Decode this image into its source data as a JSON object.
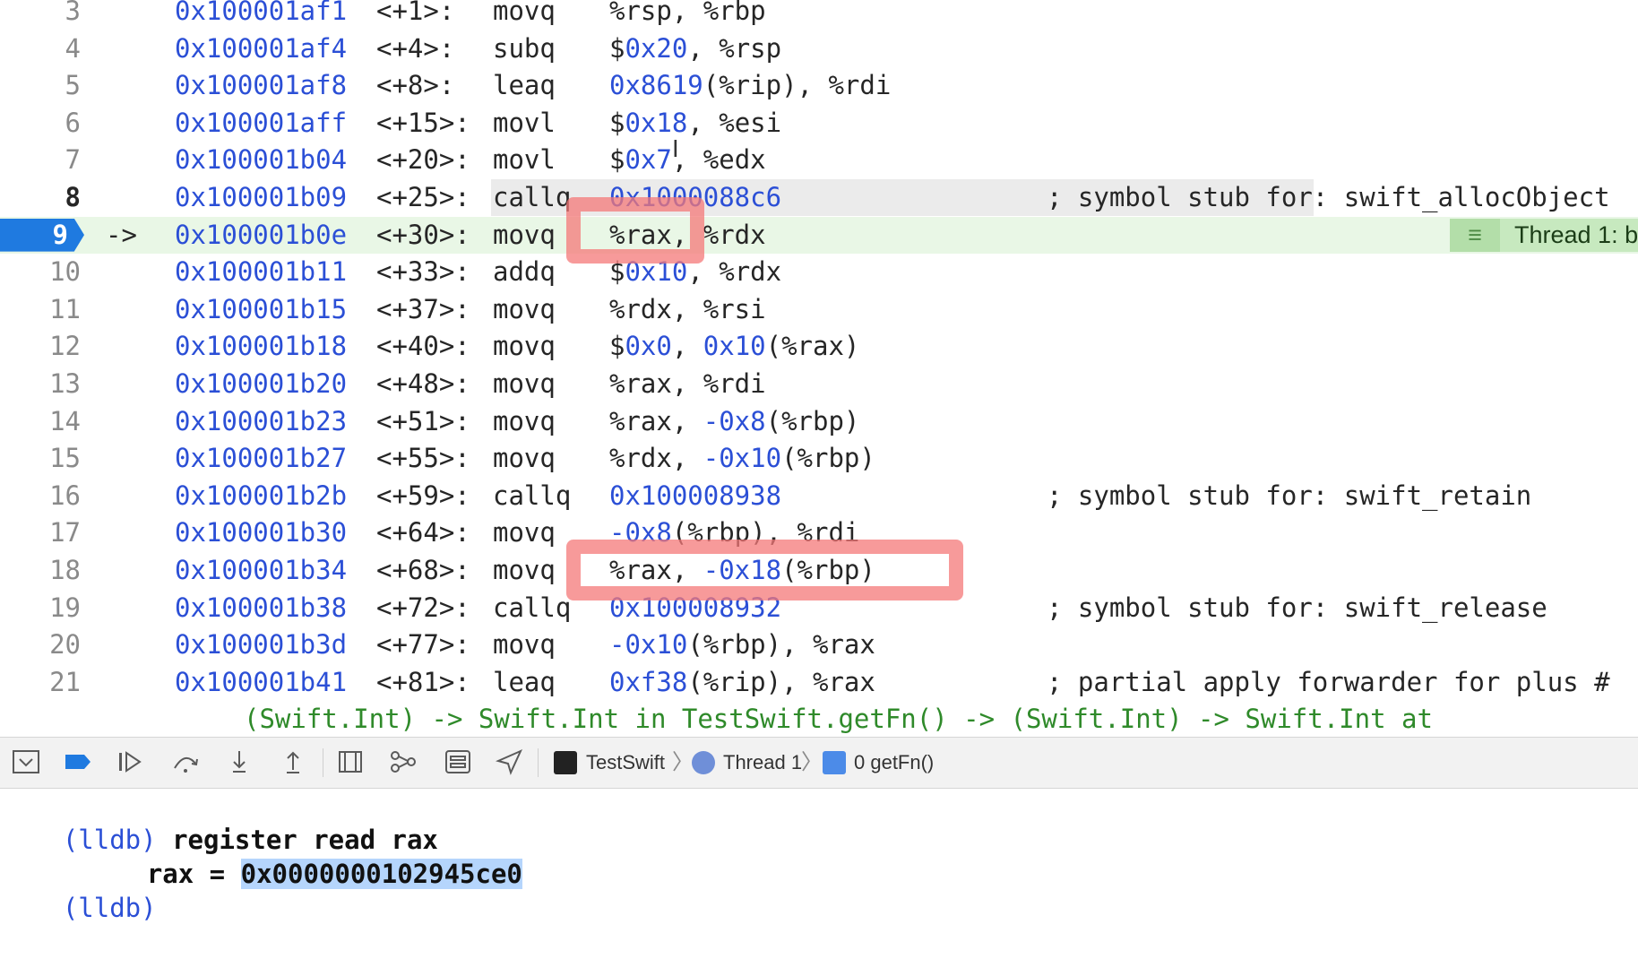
{
  "editor": {
    "lines": [
      {
        "num": "3",
        "arrow": "",
        "addr": "0x100001af1",
        "offset": "<+1>:",
        "mnemonic": "movq",
        "ops": [
          [
            "%rsp, %rbp",
            false
          ]
        ],
        "comment": ""
      },
      {
        "num": "4",
        "arrow": "",
        "addr": "0x100001af4",
        "offset": "<+4>:",
        "mnemonic": "subq",
        "ops": [
          [
            "$",
            false
          ],
          [
            "0x20",
            true
          ],
          [
            ", %rsp",
            false
          ]
        ],
        "comment": ""
      },
      {
        "num": "5",
        "arrow": "",
        "addr": "0x100001af8",
        "offset": "<+8>:",
        "mnemonic": "leaq",
        "ops": [
          [
            "0x8619",
            true
          ],
          [
            "(%rip), %rdi",
            false
          ]
        ],
        "comment": ""
      },
      {
        "num": "6",
        "arrow": "",
        "addr": "0x100001aff",
        "offset": "<+15>:",
        "mnemonic": "movl",
        "ops": [
          [
            "$",
            false
          ],
          [
            "0x18",
            true
          ],
          [
            ", %esi",
            false
          ]
        ],
        "comment": ""
      },
      {
        "num": "7",
        "arrow": "",
        "addr": "0x100001b04",
        "offset": "<+20>:",
        "mnemonic": "movl",
        "ops": [
          [
            "$",
            false
          ],
          [
            "0x7",
            true
          ],
          [
            ", %edx",
            false
          ]
        ],
        "comment": ""
      },
      {
        "num": "8",
        "arrow": "",
        "addr": "0x100001b09",
        "offset": "<+25>:",
        "mnemonic": "callq",
        "ops": [
          [
            "0x1000088c6",
            true
          ]
        ],
        "comment": "; symbol stub for: swift_allocObject"
      },
      {
        "num": "9",
        "arrow": "->",
        "addr": "0x100001b0e",
        "offset": "<+30>:",
        "mnemonic": "movq",
        "ops": [
          [
            "%rax, %rdx",
            false
          ]
        ],
        "comment": ""
      },
      {
        "num": "10",
        "arrow": "",
        "addr": "0x100001b11",
        "offset": "<+33>:",
        "mnemonic": "addq",
        "ops": [
          [
            "$",
            false
          ],
          [
            "0x10",
            true
          ],
          [
            ", %rdx",
            false
          ]
        ],
        "comment": ""
      },
      {
        "num": "11",
        "arrow": "",
        "addr": "0x100001b15",
        "offset": "<+37>:",
        "mnemonic": "movq",
        "ops": [
          [
            "%rdx, %rsi",
            false
          ]
        ],
        "comment": ""
      },
      {
        "num": "12",
        "arrow": "",
        "addr": "0x100001b18",
        "offset": "<+40>:",
        "mnemonic": "movq",
        "ops": [
          [
            "$",
            false
          ],
          [
            "0x0",
            true
          ],
          [
            ", ",
            false
          ],
          [
            "0x10",
            true
          ],
          [
            "(%rax)",
            false
          ]
        ],
        "comment": ""
      },
      {
        "num": "13",
        "arrow": "",
        "addr": "0x100001b20",
        "offset": "<+48>:",
        "mnemonic": "movq",
        "ops": [
          [
            "%rax, %rdi",
            false
          ]
        ],
        "comment": ""
      },
      {
        "num": "14",
        "arrow": "",
        "addr": "0x100001b23",
        "offset": "<+51>:",
        "mnemonic": "movq",
        "ops": [
          [
            "%rax, ",
            false
          ],
          [
            "-0x8",
            true
          ],
          [
            "(%rbp)",
            false
          ]
        ],
        "comment": ""
      },
      {
        "num": "15",
        "arrow": "",
        "addr": "0x100001b27",
        "offset": "<+55>:",
        "mnemonic": "movq",
        "ops": [
          [
            "%rdx, ",
            false
          ],
          [
            "-0x10",
            true
          ],
          [
            "(%rbp)",
            false
          ]
        ],
        "comment": ""
      },
      {
        "num": "16",
        "arrow": "",
        "addr": "0x100001b2b",
        "offset": "<+59>:",
        "mnemonic": "callq",
        "ops": [
          [
            "0x100008938",
            true
          ]
        ],
        "comment": "; symbol stub for: swift_retain"
      },
      {
        "num": "17",
        "arrow": "",
        "addr": "0x100001b30",
        "offset": "<+64>:",
        "mnemonic": "movq",
        "ops": [
          [
            "-0x8",
            true
          ],
          [
            "(%rbp), %rdi",
            false
          ]
        ],
        "comment": ""
      },
      {
        "num": "18",
        "arrow": "",
        "addr": "0x100001b34",
        "offset": "<+68>:",
        "mnemonic": "movq",
        "ops": [
          [
            "%rax, ",
            false
          ],
          [
            "-0x18",
            true
          ],
          [
            "(%rbp)",
            false
          ]
        ],
        "comment": ""
      },
      {
        "num": "19",
        "arrow": "",
        "addr": "0x100001b38",
        "offset": "<+72>:",
        "mnemonic": "callq",
        "ops": [
          [
            "0x100008932",
            true
          ]
        ],
        "comment": "; symbol stub for: swift_release"
      },
      {
        "num": "20",
        "arrow": "",
        "addr": "0x100001b3d",
        "offset": "<+77>:",
        "mnemonic": "movq",
        "ops": [
          [
            "-0x10",
            true
          ],
          [
            "(%rbp), %rax",
            false
          ]
        ],
        "comment": ""
      },
      {
        "num": "21",
        "arrow": "",
        "addr": "0x100001b41",
        "offset": "<+81>:",
        "mnemonic": "leaq",
        "ops": [
          [
            "0xf38",
            true
          ],
          [
            "(%rip), %rax",
            false
          ]
        ],
        "comment": "; partial apply forwarder for plus #"
      }
    ],
    "continuation": "(Swift.Int) -> Swift.Int in TestSwift.getFn() -> (Swift.Int) -> Swift.Int at",
    "current_line": "9",
    "thread_badge": "Thread 1: b",
    "colors": {
      "pc_marker": "#1f7ae0",
      "current_line_bg": "#e9f7e6",
      "address": "#2b4fd6",
      "annotation_box": "#f47878"
    }
  },
  "toolbar": {
    "buttons": [
      "hide-console",
      "toggle-breakpoints",
      "continue",
      "step-over",
      "step-into",
      "step-out",
      "view-debugger",
      "memory-graph",
      "environment-overrides",
      "simulate-location"
    ],
    "breadcrumb": {
      "target": "TestSwift",
      "thread": "Thread 1",
      "frame": "0 getFn()"
    }
  },
  "console": {
    "prompt": "(lldb)",
    "command": "register read rax",
    "reg_name": "rax =",
    "reg_value": "0x0000000102945ce0"
  }
}
